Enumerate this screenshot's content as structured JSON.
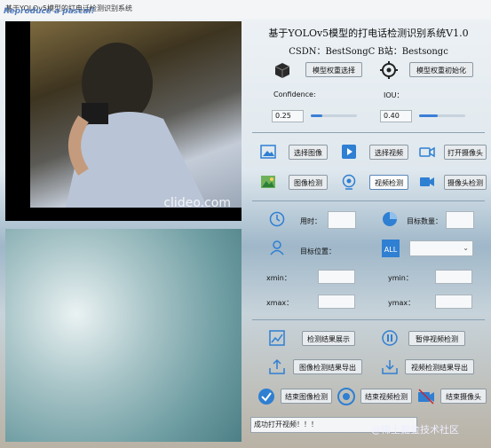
{
  "window": {
    "title": "基于YOLOv5模型的打电话检测识别系统",
    "watermark": "Reproduce a pascal!"
  },
  "video": {
    "watermark": "clideo.com"
  },
  "header": {
    "title": "基于YOLOv5模型的打电话检测识别系统V1.0",
    "subtitle": "CSDN：BestSongC  B站：Bestsongc"
  },
  "model": {
    "select_label": "模型权重选择",
    "init_label": "模型权重初始化"
  },
  "params": {
    "confidence_label": "Confidence:",
    "confidence_value": "0.25",
    "confidence_fraction": 0.25,
    "iou_label": "IOU：",
    "iou_value": "0.40",
    "iou_fraction": 0.4
  },
  "inputs": {
    "select_image": "选择图像",
    "select_video": "选择视频",
    "open_camera": "打开摄像头",
    "image_detect": "图像检测",
    "video_detect": "视频检测",
    "camera_detect": "摄像头检测"
  },
  "results": {
    "time_label": "用时：",
    "count_label": "目标数量：",
    "position_label": "目标位置：",
    "xmin_label": "xmin：",
    "ymin_label": "ymin：",
    "xmax_label": "xmax：",
    "ymax_label": "ymax：",
    "time_value": "",
    "count_value": "",
    "xmin_value": "",
    "ymin_value": "",
    "xmax_value": "",
    "ymax_value": "",
    "position_value": ""
  },
  "actions": {
    "show_results": "检测结果展示",
    "pause_video": "暂停视频检测",
    "export_image": "图像检测结果导出",
    "export_video": "视频检测结果导出",
    "end_image": "结束图像检测",
    "end_video": "结束视频检测",
    "end_camera": "结束摄像头"
  },
  "status": {
    "text": "成功打开视频！！！"
  },
  "corner_watermark": "@稀土掘金技术社区",
  "colors": {
    "accent": "#3a7fd6",
    "icon_blue": "#2f7fd2"
  }
}
